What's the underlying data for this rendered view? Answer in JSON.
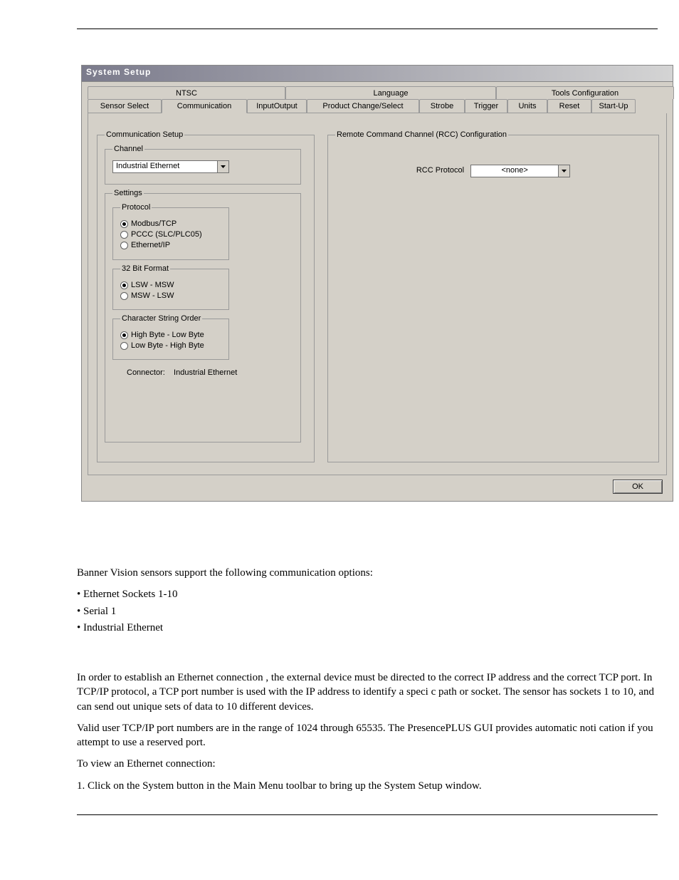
{
  "dialog": {
    "title": "System Setup",
    "tabsTop": [
      {
        "label": "NTSC",
        "flex": 278
      },
      {
        "label": "Language",
        "flex": 296
      },
      {
        "label": "Tools Configuration",
        "flex": 250
      }
    ],
    "tabsSecond": [
      {
        "label": "Sensor Select",
        "flex": 104
      },
      {
        "label": "Communication",
        "flex": 120,
        "selected": true
      },
      {
        "label": "InputOutput",
        "flex": 84
      },
      {
        "label": "Product Change/Select",
        "flex": 158
      },
      {
        "label": "Strobe",
        "flex": 64
      },
      {
        "label": "Trigger",
        "flex": 60
      },
      {
        "label": "Units",
        "flex": 56
      },
      {
        "label": "Reset",
        "flex": 62
      },
      {
        "label": "Start-Up",
        "flex": 62
      }
    ],
    "commSetup": {
      "legend": "Communication Setup",
      "channel": {
        "legend": "Channel",
        "value": "Industrial Ethernet"
      },
      "settings": {
        "legend": "Settings",
        "protocol": {
          "legend": "Protocol",
          "options": [
            {
              "label": "Modbus/TCP",
              "checked": true
            },
            {
              "label": "PCCC (SLC/PLC05)",
              "checked": false
            },
            {
              "label": "Ethernet/IP",
              "checked": false
            }
          ]
        },
        "bitFormat": {
          "legend": "32 Bit Format",
          "options": [
            {
              "label": "LSW - MSW",
              "checked": true
            },
            {
              "label": "MSW - LSW",
              "checked": false
            }
          ]
        },
        "charOrder": {
          "legend": "Character String Order",
          "options": [
            {
              "label": "High Byte - Low Byte",
              "checked": true
            },
            {
              "label": "Low Byte - High Byte",
              "checked": false
            }
          ]
        },
        "connectorLabel": "Connector:",
        "connectorValue": "Industrial Ethernet"
      }
    },
    "rcc": {
      "legend": "Remote Command Channel (RCC) Configuration",
      "protocolLabel": "RCC Protocol",
      "protocolValue": "<none>"
    },
    "okLabel": "OK"
  },
  "prose": {
    "p1": "Banner Vision sensors support the following communication options:",
    "bullets": [
      "• Ethernet Sockets 1-10",
      "• Serial 1",
      "• Industrial Ethernet"
    ],
    "p2": "In order to establish an Ethernet connection , the external device must be directed to the correct IP address and the correct TCP port. In TCP/IP protocol, a TCP port number is used with the IP address to identify a speci c path or socket. The sensor has sockets 1 to 10, and can send out unique sets of data to 10 different devices.",
    "p3": "Valid user TCP/IP port numbers are in the range of 1024 through 65535. The PresencePLUS GUI provides automatic noti cation if you attempt to use a reserved port.",
    "p4": "To view an Ethernet connection:",
    "step1": "1.   Click on the System button in the Main Menu toolbar to bring up the System Setup window."
  }
}
